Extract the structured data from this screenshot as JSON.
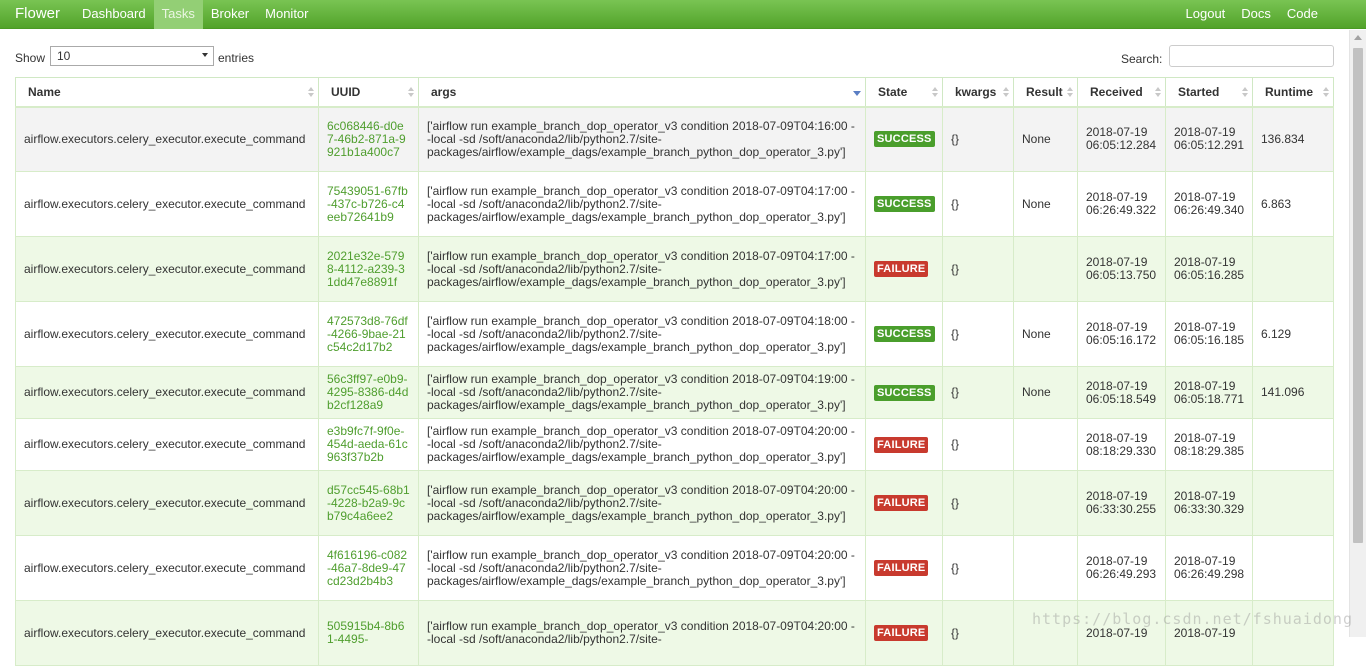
{
  "navbar": {
    "brand": "Flower",
    "left_items": [
      {
        "label": "Dashboard",
        "active": false
      },
      {
        "label": "Tasks",
        "active": true
      },
      {
        "label": "Broker",
        "active": false
      },
      {
        "label": "Monitor",
        "active": false
      }
    ],
    "right_items": [
      {
        "label": "Logout"
      },
      {
        "label": "Docs"
      },
      {
        "label": "Code"
      }
    ]
  },
  "controls": {
    "show_label": "Show",
    "page_size": "10",
    "entries_label": "entries",
    "search_label": "Search:",
    "search_value": ""
  },
  "table": {
    "columns": [
      "Name",
      "UUID",
      "args",
      "State",
      "kwargs",
      "Result",
      "Received",
      "Started",
      "Runtime"
    ],
    "rows": [
      {
        "name": "airflow.executors.celery_executor.execute_command",
        "uuid": "6c068446-d0e7-46b2-871a-9921b1a400c7",
        "args": "['airflow run example_branch_dop_operator_v3 condition 2018-07-09T04:16:00 --local -sd /soft/anaconda2/lib/python2.7/site-packages/airflow/example_dags/example_branch_python_dop_operator_3.py']",
        "state": "SUCCESS",
        "kwargs": "{}",
        "result": "None",
        "received": "2018-07-19 06:05:12.284",
        "started": "2018-07-19 06:05:12.291",
        "runtime": "136.834"
      },
      {
        "name": "airflow.executors.celery_executor.execute_command",
        "uuid": "75439051-67fb-437c-b726-c4eeb72641b9",
        "args": "['airflow run example_branch_dop_operator_v3 condition 2018-07-09T04:17:00 --local -sd /soft/anaconda2/lib/python2.7/site-packages/airflow/example_dags/example_branch_python_dop_operator_3.py']",
        "state": "SUCCESS",
        "kwargs": "{}",
        "result": "None",
        "received": "2018-07-19 06:26:49.322",
        "started": "2018-07-19 06:26:49.340",
        "runtime": "6.863"
      },
      {
        "name": "airflow.executors.celery_executor.execute_command",
        "uuid": "2021e32e-5798-4112-a239-31dd47e8891f",
        "args": "['airflow run example_branch_dop_operator_v3 condition 2018-07-09T04:17:00 --local -sd /soft/anaconda2/lib/python2.7/site-packages/airflow/example_dags/example_branch_python_dop_operator_3.py']",
        "state": "FAILURE",
        "kwargs": "{}",
        "result": "",
        "received": "2018-07-19 06:05:13.750",
        "started": "2018-07-19 06:05:16.285",
        "runtime": ""
      },
      {
        "name": "airflow.executors.celery_executor.execute_command",
        "uuid": "472573d8-76df-4266-9bae-21c54c2d17b2",
        "args": "['airflow run example_branch_dop_operator_v3 condition 2018-07-09T04:18:00 --local -sd /soft/anaconda2/lib/python2.7/site-packages/airflow/example_dags/example_branch_python_dop_operator_3.py']",
        "state": "SUCCESS",
        "kwargs": "{}",
        "result": "None",
        "received": "2018-07-19 06:05:16.172",
        "started": "2018-07-19 06:05:16.185",
        "runtime": "6.129"
      },
      {
        "name": "airflow.executors.celery_executor.execute_command",
        "uuid": "56c3ff97-e0b9-4295-8386-d4db2cf128a9",
        "args": "['airflow run example_branch_dop_operator_v3 condition 2018-07-09T04:19:00 --local -sd /soft/anaconda2/lib/python2.7/site-packages/airflow/example_dags/example_branch_python_dop_operator_3.py']",
        "state": "SUCCESS",
        "kwargs": "{}",
        "result": "None",
        "received": "2018-07-19 06:05:18.549",
        "started": "2018-07-19 06:05:18.771",
        "runtime": "141.096"
      },
      {
        "name": "airflow.executors.celery_executor.execute_command",
        "uuid": "e3b9fc7f-9f0e-454d-aeda-61c963f37b2b",
        "args": "['airflow run example_branch_dop_operator_v3 condition 2018-07-09T04:20:00 --local -sd /soft/anaconda2/lib/python2.7/site-packages/airflow/example_dags/example_branch_python_dop_operator_3.py']",
        "state": "FAILURE",
        "kwargs": "{}",
        "result": "",
        "received": "2018-07-19 08:18:29.330",
        "started": "2018-07-19 08:18:29.385",
        "runtime": ""
      },
      {
        "name": "airflow.executors.celery_executor.execute_command",
        "uuid": "d57cc545-68b1-4228-b2a9-9cb79c4a6ee2",
        "args": "['airflow run example_branch_dop_operator_v3 condition 2018-07-09T04:20:00 --local -sd /soft/anaconda2/lib/python2.7/site-packages/airflow/example_dags/example_branch_python_dop_operator_3.py']",
        "state": "FAILURE",
        "kwargs": "{}",
        "result": "",
        "received": "2018-07-19 06:33:30.255",
        "started": "2018-07-19 06:33:30.329",
        "runtime": ""
      },
      {
        "name": "airflow.executors.celery_executor.execute_command",
        "uuid": "4f616196-c082-46a7-8de9-47cd23d2b4b3",
        "args": "['airflow run example_branch_dop_operator_v3 condition 2018-07-09T04:20:00 --local -sd /soft/anaconda2/lib/python2.7/site-packages/airflow/example_dags/example_branch_python_dop_operator_3.py']",
        "state": "FAILURE",
        "kwargs": "{}",
        "result": "",
        "received": "2018-07-19 06:26:49.293",
        "started": "2018-07-19 06:26:49.298",
        "runtime": ""
      },
      {
        "name": "airflow.executors.celery_executor.execute_command",
        "uuid": "505915b4-8b61-4495-",
        "args": "['airflow run example_branch_dop_operator_v3 condition 2018-07-09T04:20:00 --local -sd /soft/anaconda2/lib/python2.7/site-",
        "state": "FAILURE",
        "kwargs": "{}",
        "result": "",
        "received": "2018-07-19",
        "started": "2018-07-19",
        "runtime": ""
      }
    ]
  },
  "watermark": "https://blog.csdn.net/fshuaidong"
}
